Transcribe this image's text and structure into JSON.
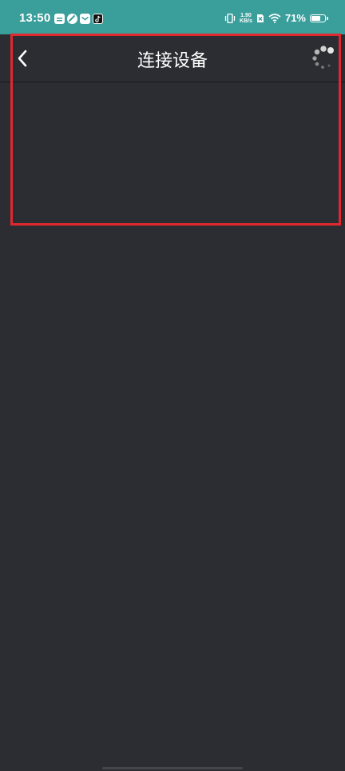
{
  "status_bar": {
    "time": "13:50",
    "net_speed_value": "1.90",
    "net_speed_unit": "KB/s",
    "battery_percent": "71%",
    "battery_level": 0.71,
    "notification_icons": [
      "calendar-icon",
      "link-icon",
      "mail-icon",
      "tiktok-icon"
    ],
    "system_icons": [
      "vibrate-icon",
      "no-sim-icon",
      "wifi-icon",
      "battery-icon"
    ]
  },
  "app_bar": {
    "title": "连接设备",
    "back_icon": "chevron-left-icon",
    "spinner_icon": "loading-spinner-icon"
  },
  "colors": {
    "status_bar_bg": "#3a9e9b",
    "background": "#2b2d32",
    "highlight": "#e0282e",
    "text": "#ffffff"
  }
}
